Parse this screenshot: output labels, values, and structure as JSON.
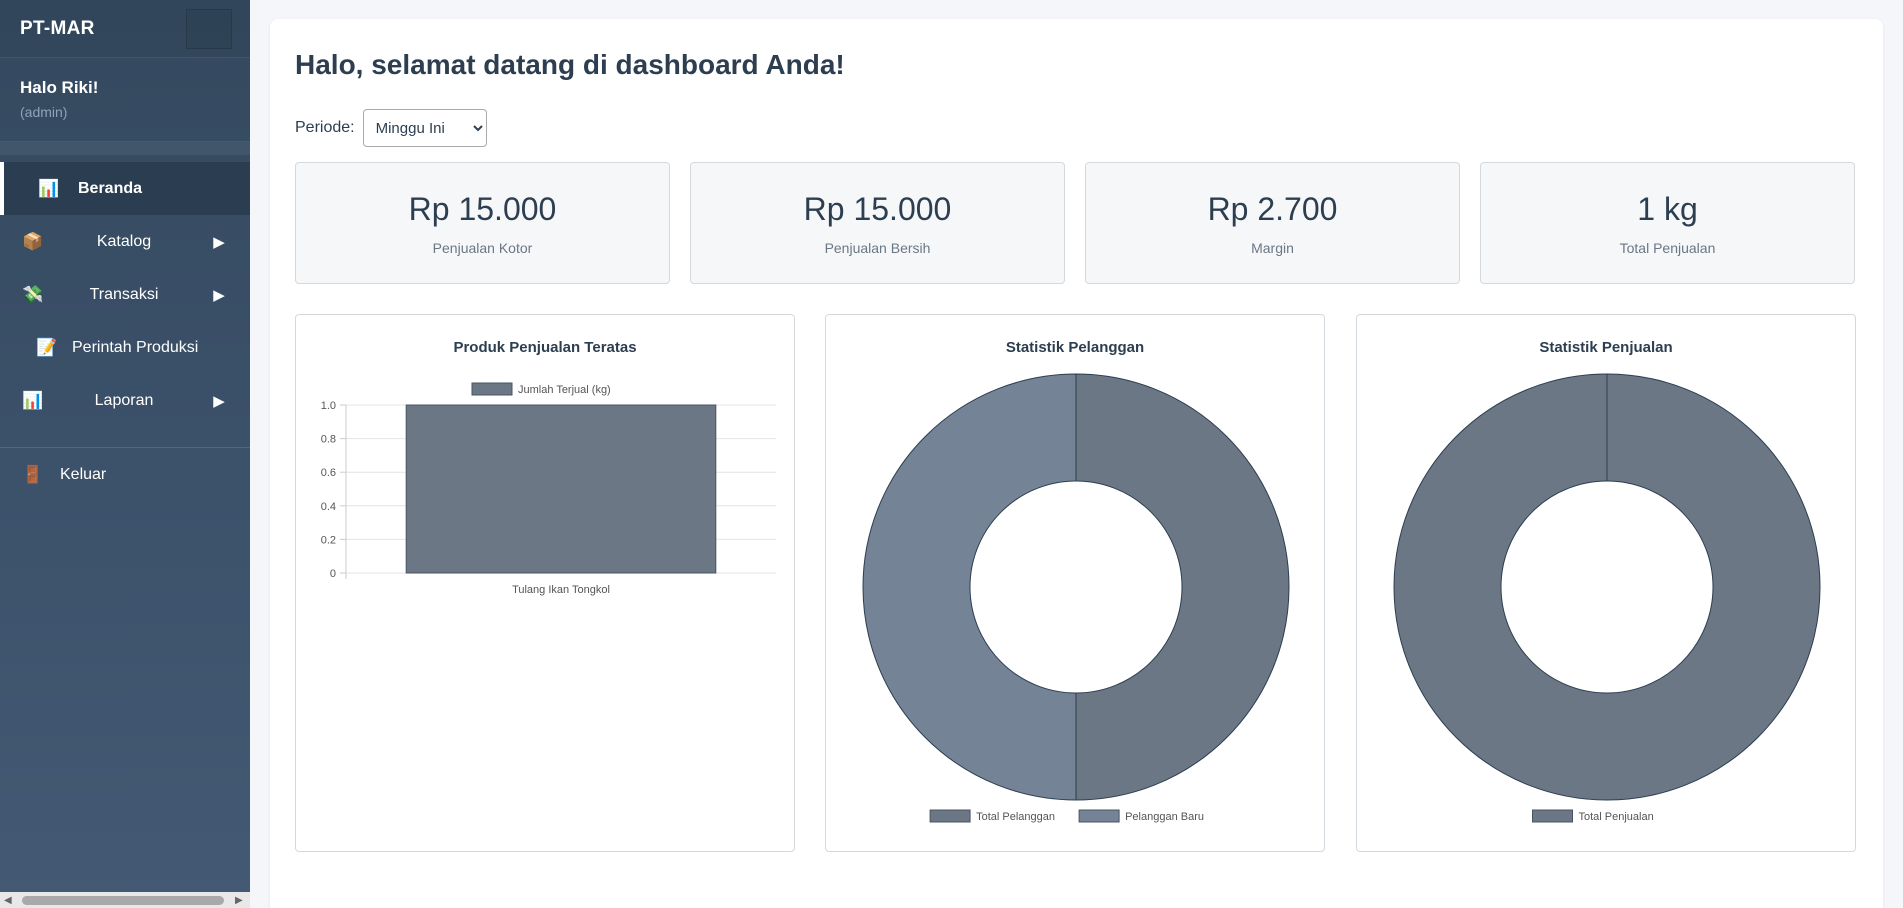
{
  "sidebar": {
    "brand": "PT-MAR",
    "toggle_icon": "←",
    "user_greeting": "Halo Riki!",
    "user_role": "(admin)",
    "items": [
      {
        "label": "Beranda",
        "icon": "📊",
        "has_arrow": false,
        "active": true
      },
      {
        "label": "Katalog",
        "icon": "📦",
        "has_arrow": true,
        "active": false
      },
      {
        "label": "Transaksi",
        "icon": "💸",
        "has_arrow": true,
        "active": false
      },
      {
        "label": "Perintah Produksi",
        "icon": "📝",
        "has_arrow": false,
        "active": false
      },
      {
        "label": "Laporan",
        "icon": "📊",
        "has_arrow": true,
        "active": false
      }
    ],
    "logout_label": "Keluar",
    "logout_icon": "🚪",
    "arrow_glyph": "▶"
  },
  "main": {
    "title": "Halo, selamat datang di dashboard Anda!",
    "period_label": "Periode:",
    "period_value": "Minggu Ini",
    "stats": [
      {
        "value": "Rp 15.000",
        "label": "Penjualan Kotor"
      },
      {
        "value": "Rp 15.000",
        "label": "Penjualan Bersih"
      },
      {
        "value": "Rp 2.700",
        "label": "Margin"
      },
      {
        "value": "1 kg",
        "label": "Total Penjualan"
      }
    ]
  },
  "colors": {
    "sidebar_bg": "#34495e",
    "bar_fill": "#6b7785",
    "donut_a": "#6b7785",
    "donut_b": "#748396"
  },
  "chart_data": [
    {
      "type": "bar",
      "title": "Produk Penjualan Teratas",
      "categories": [
        "Tulang Ikan Tongkol"
      ],
      "series": [
        {
          "name": "Jumlah Terjual (kg)",
          "values": [
            1
          ]
        }
      ],
      "yticks": [
        "0",
        "0.2",
        "0.4",
        "0.6",
        "0.8",
        "1.0"
      ],
      "ylim": [
        0,
        1
      ],
      "legend": "top",
      "grid": true
    },
    {
      "type": "pie",
      "title": "Statistik Pelanggan",
      "labels": [
        "Total Pelanggan",
        "Pelanggan Baru"
      ],
      "values": [
        1,
        1
      ],
      "legend": "bottom"
    },
    {
      "type": "pie",
      "title": "Statistik Penjualan",
      "labels": [
        "Total Penjualan"
      ],
      "values": [
        1
      ],
      "legend": "bottom"
    }
  ]
}
